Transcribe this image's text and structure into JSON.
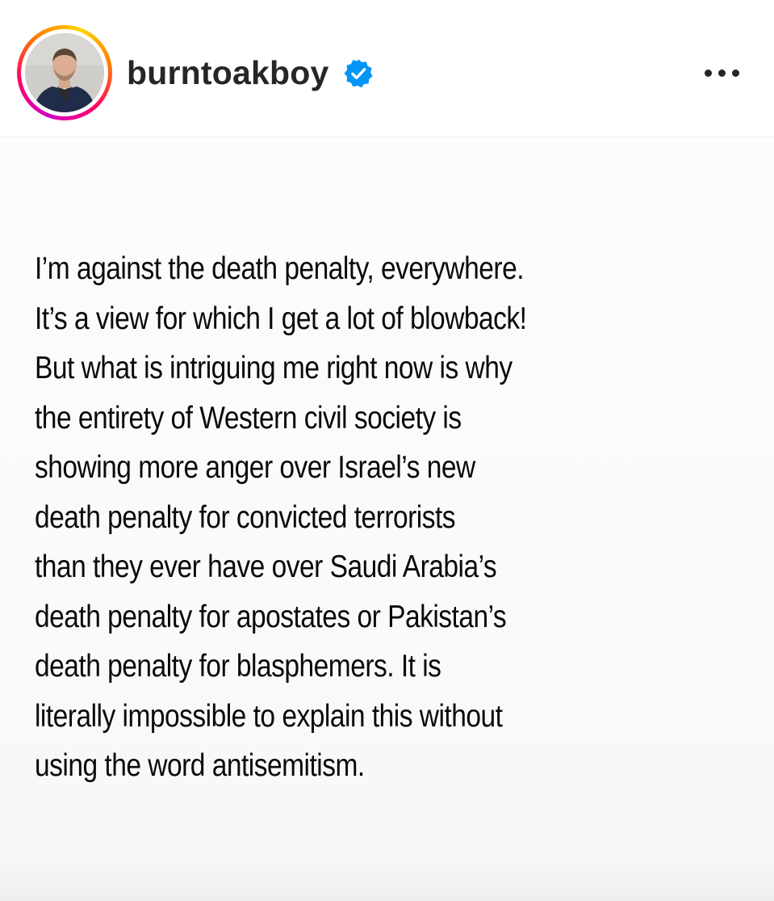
{
  "post": {
    "username": "burntoakboy",
    "verified": true,
    "accent_color": "#0095f6",
    "story_ring_colors": [
      "#d300c5",
      "#ff0069",
      "#ff7a00",
      "#ffd600"
    ],
    "more_icon": "more-horizontal-icon",
    "text_lines": [
      "I’m against the death penalty, everywhere.",
      "It’s a view for which I get a lot of blowback!",
      "But what is intriguing me right now is why",
      "the entirety of Western civil society is",
      "showing more anger over Israel’s new",
      "death penalty for convicted terrorists",
      "than they ever have over Saudi Arabia’s",
      "death penalty for apostates or Pakistan’s",
      "death penalty for blasphemers. It is",
      "literally impossible to explain this without",
      "using the word antisemitism."
    ]
  }
}
